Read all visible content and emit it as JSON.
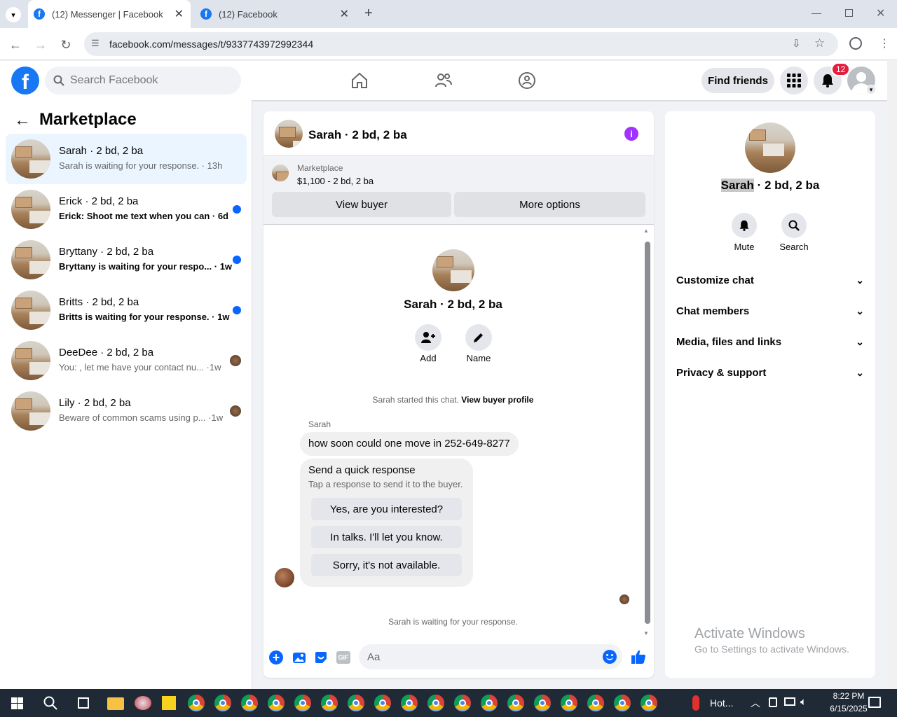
{
  "browser": {
    "tabs": [
      {
        "title": "(12) Messenger | Facebook"
      },
      {
        "title": "(12) Facebook"
      }
    ],
    "url": "facebook.com/messages/t/9337743972992344"
  },
  "fb_header": {
    "search_placeholder": "Search Facebook",
    "find_friends": "Find friends",
    "notification_count": "12"
  },
  "left": {
    "title": "Marketplace",
    "conversations": [
      {
        "name": "Sarah · 2 bd, 2 ba",
        "preview": "Sarah is waiting for your response. · 13h"
      },
      {
        "name": "Erick · 2 bd, 2 ba",
        "preview": "Erick: Shoot me text when you can · 6d"
      },
      {
        "name": "Bryttany · 2 bd, 2 ba",
        "preview": "Bryttany is waiting for your respo... · 1w"
      },
      {
        "name": "Britts · 2 bd, 2 ba",
        "preview": "Britts is waiting for your response. · 1w"
      },
      {
        "name": "DeeDee · 2 bd, 2 ba",
        "preview": "You: , let me have your contact nu... ·1w"
      },
      {
        "name": "Lily · 2 bd, 2 ba",
        "preview": "Beware of common scams using p... ·1w"
      }
    ]
  },
  "chat": {
    "title": "Sarah · 2 bd, 2 ba",
    "marketplace_label": "Marketplace",
    "listing": "$1,100 - 2 bd, 2 ba",
    "view_buyer": "View buyer",
    "more_options": "More options",
    "profile_name": "Sarah · 2 bd, 2 ba",
    "add_label": "Add",
    "name_label": "Name",
    "started_text": "Sarah started this chat.",
    "view_profile": "View buyer profile",
    "sender": "Sarah",
    "message": "how soon could one move in 252-649-8277",
    "quick_title": "Send a quick response",
    "quick_sub": "Tap a response to send it to the buyer.",
    "quick_responses": [
      "Yes, are you interested?",
      "In talks. I'll let you know.",
      "Sorry, it's not available."
    ],
    "waiting": "Sarah is waiting for your response.",
    "composer_placeholder": "Aa",
    "gif_label": "GIF"
  },
  "right": {
    "name_first": "Sarah",
    "name_rest": " · 2 bd, 2 ba",
    "mute": "Mute",
    "search": "Search",
    "sections": [
      "Customize chat",
      "Chat members",
      "Media, files and links",
      "Privacy & support"
    ],
    "watermark_title": "Activate Windows",
    "watermark_sub": "Go to Settings to activate Windows."
  },
  "taskbar": {
    "weather": "Hot...",
    "time": "8:22 PM",
    "date": "6/15/2025"
  },
  "colors": {
    "fb_blue": "#1877f2",
    "unread_dot": "#0866ff",
    "purple_info": "#a033ff"
  }
}
